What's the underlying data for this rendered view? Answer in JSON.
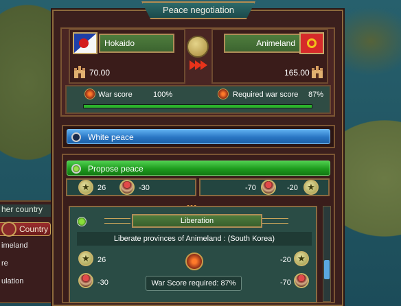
{
  "window_title": "Peace negotiation",
  "side_panel": {
    "title": "her country",
    "button_label": "Country",
    "items": [
      "imeland",
      "re",
      "ulation"
    ]
  },
  "left_country": {
    "name": "Hokaido",
    "value": "70.00"
  },
  "right_country": {
    "name": "Animeland",
    "value": "165.00"
  },
  "war_score": {
    "label": "War score",
    "value": "100%",
    "required_label": "Required war score",
    "required_value": "87%",
    "fill_fraction": 1.0
  },
  "options": {
    "white_peace": "White peace",
    "propose_peace": "Propose peace"
  },
  "comparison": {
    "left_star": "26",
    "left_soldier": "-30",
    "right_soldier": "-70",
    "right_star": "-20"
  },
  "liberation": {
    "title": "Liberation",
    "description": "Liberate provinces of Animeland : (South Korea)",
    "left_star": "26",
    "left_soldier": "-30",
    "right_star": "-20",
    "right_soldier": "-70",
    "required": "War Score required: 87%"
  },
  "colors": {
    "accent_green": "#2cb32c",
    "accent_blue": "#2a76c4",
    "frame_gold": "#8c6a3c"
  }
}
